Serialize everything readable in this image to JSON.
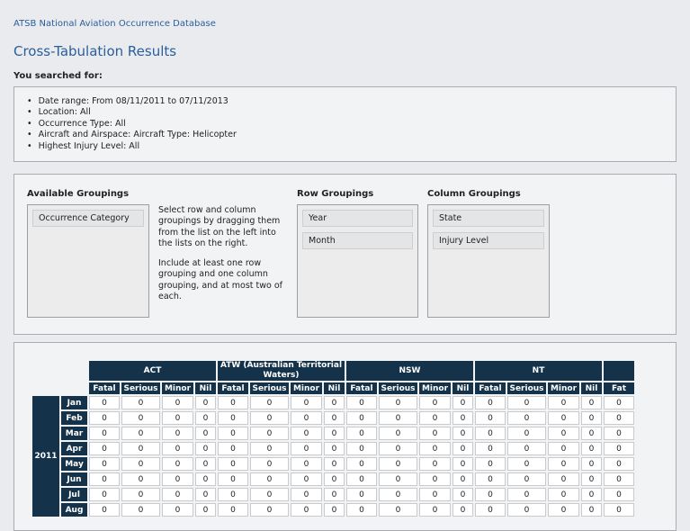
{
  "header": {
    "breadcrumb": "ATSB National Aviation Occurrence Database",
    "title": "Cross-Tabulation Results",
    "searched_label": "You searched for:"
  },
  "criteria": [
    "Date range: From 08/11/2011 to 07/11/2013",
    "Location: All",
    "Occurrence Type: All",
    "Aircraft and Airspace: Aircraft Type: Helicopter",
    "Highest Injury Level: All"
  ],
  "groupings": {
    "available_heading": "Available Groupings",
    "available": [
      "Occurrence Category"
    ],
    "instructions": [
      "Select row and column groupings by dragging them from the list on the left into the lists on the right.",
      "Include at least one row grouping and one column grouping, and at most two of each."
    ],
    "row_heading": "Row Groupings",
    "rows": [
      "Year",
      "Month"
    ],
    "col_heading": "Column Groupings",
    "cols": [
      "State",
      "Injury Level"
    ]
  },
  "table": {
    "states": [
      "ACT",
      "ATW (Australian Territorial Waters)",
      "NSW",
      "NT",
      ""
    ],
    "injury_levels": [
      "Fatal",
      "Serious",
      "Minor",
      "Nil"
    ],
    "partial_header": "Fat",
    "year": "2011",
    "months": [
      "Jan",
      "Feb",
      "Mar",
      "Apr",
      "May",
      "Jun",
      "Jul",
      "Aug"
    ],
    "cell_value": "0"
  }
}
